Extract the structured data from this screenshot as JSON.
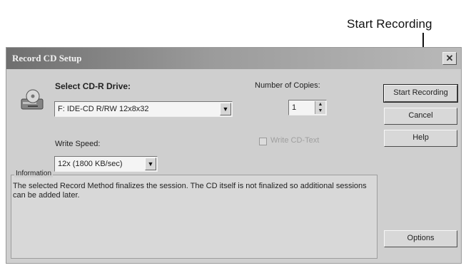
{
  "callout": {
    "label": "Start Recording"
  },
  "dialog": {
    "title": "Record CD Setup",
    "close_symbol": "✕",
    "drive_label": "Select CD-R Drive:",
    "drive_value": "F: IDE-CD R/RW 12x8x32",
    "copies_label": "Number of Copies:",
    "copies_value": "1",
    "speed_label": "Write Speed:",
    "speed_value": "12x (1800 KB/sec)",
    "write_cd_text_label": "Write CD-Text",
    "buttons": {
      "start": "Start Recording",
      "cancel": "Cancel",
      "help": "Help",
      "options": "Options"
    },
    "information": {
      "title": "Information",
      "text": "The selected Record Method finalizes the session. The CD itself is not finalized so additional sessions can be added later."
    }
  },
  "icons": {
    "drive_icon": "cd-drive-icon",
    "dropdown_icon": "chevron-down-icon",
    "spinner_icon": "spinner-arrows-icon"
  }
}
